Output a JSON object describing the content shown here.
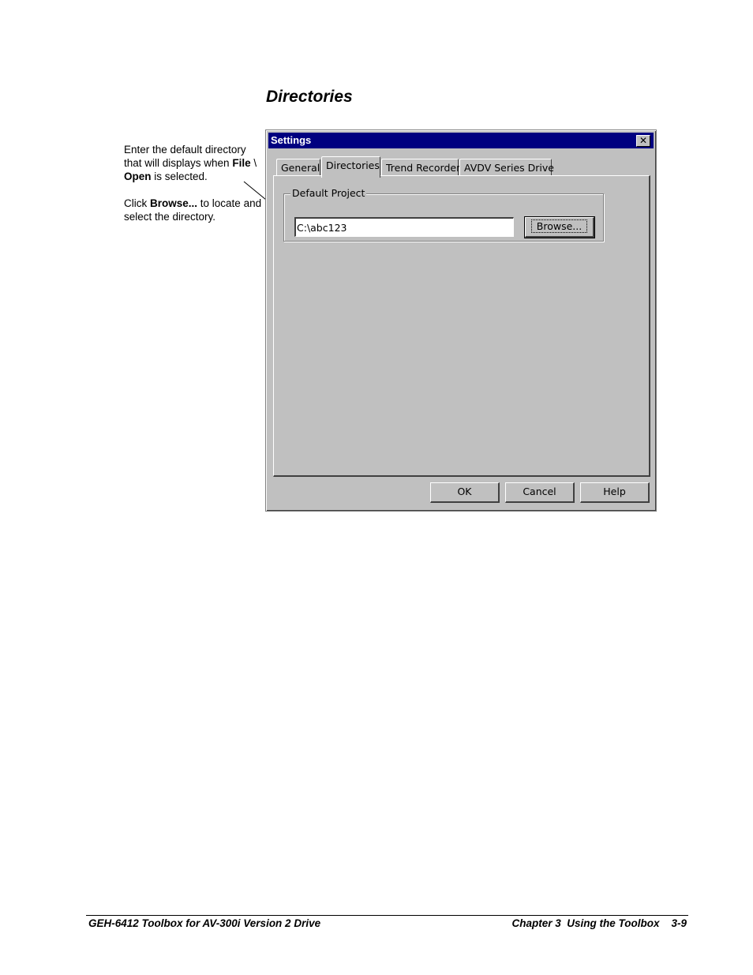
{
  "heading": "Directories",
  "notes": {
    "note1": {
      "before": "Enter the default directory that will displays when ",
      "file": "File",
      "separator": " \\ ",
      "open": "Open",
      "after": " is selected."
    },
    "note2": {
      "before": "Click ",
      "browse": "Browse...",
      "after": " to locate and select the directory."
    }
  },
  "dialog": {
    "title": "Settings",
    "close_glyph": "✕",
    "tabs": [
      "General",
      "Directories",
      "Trend Recorder",
      "AVDV Series Drive"
    ],
    "active_tab": "Directories",
    "group_label": "Default Project",
    "path_value": "C:\\abc123",
    "browse_label": "Browse...",
    "buttons": {
      "ok": "OK",
      "cancel": "Cancel",
      "help": "Help"
    }
  },
  "footer": {
    "left": "GEH-6412 Toolbox for AV-300i Version 2 Drive",
    "right": "Chapter 3  Using the Toolbox    3-9"
  }
}
